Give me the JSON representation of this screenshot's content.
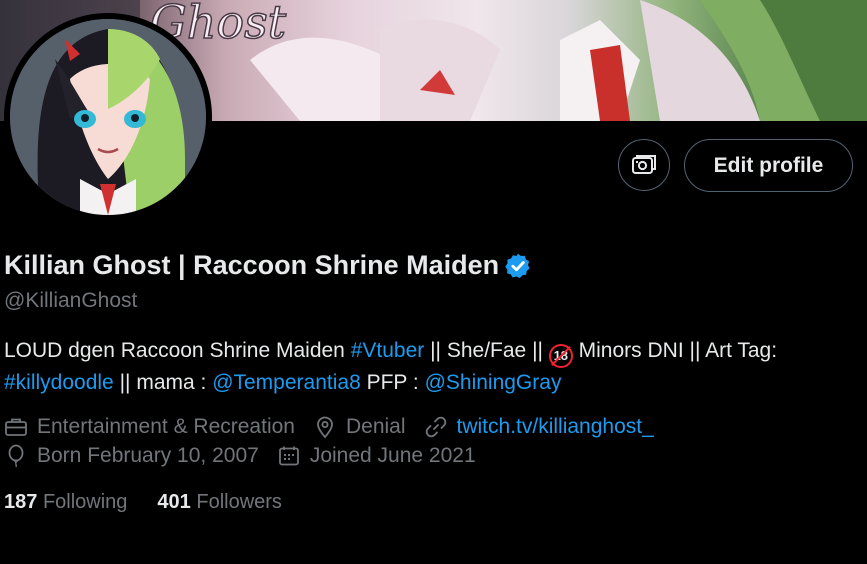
{
  "profile": {
    "name": "Killian Ghost | Raccoon Shrine Maiden",
    "handle": "@KillianGhost",
    "banner_text": "Ghost",
    "edit_profile": "Edit profile",
    "bio": {
      "p1": "LOUD dgen Raccoon Shrine Maiden ",
      "tag1": "#Vtuber",
      "p2": " || She/Fae || ",
      "dni_symbol": "18",
      "p3": " Minors DNI || Art Tag:",
      "tag2": "#killydoodle",
      "p4": " || mama : ",
      "mention1": "@Temperantia8",
      "p5": " PFP : ",
      "mention2": "@ShiningGray"
    },
    "meta": {
      "category": "Entertainment & Recreation",
      "location": "Denial",
      "website": "twitch.tv/killianghost_",
      "birthday": "Born February 10, 2007",
      "joined": "Joined June 2021"
    },
    "stats": {
      "following_count": "187",
      "following_label": "Following",
      "followers_count": "401",
      "followers_label": "Followers"
    }
  },
  "icons": {
    "verified": "verified-badge-icon",
    "banner_edit": "edit-banner-icon",
    "category": "briefcase-icon",
    "location": "location-pin-icon",
    "website": "link-icon",
    "birthday": "balloon-icon",
    "joined": "calendar-icon"
  },
  "colors": {
    "background": "#000000",
    "text": "#e7e9ea",
    "muted": "#71767b",
    "link": "#1d9bf0",
    "border": "#536471",
    "dni": "#f4212e"
  }
}
